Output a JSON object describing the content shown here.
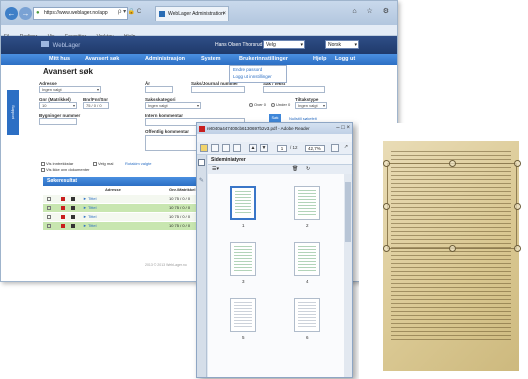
{
  "browser": {
    "url": "https://www.weblager.no/app",
    "tab_title": "WebLager Administration",
    "tab_close": "×",
    "back": "←",
    "forward": "→",
    "addr_tools": "ρ ▾ 🔒 C",
    "win_controls": "⌂ ☆ ⚙",
    "menu": [
      "Fil",
      "Rediger",
      "Vis",
      "Favoritter",
      "Verktøy",
      "Hjelp"
    ]
  },
  "site": {
    "logo": "WebLager",
    "welcome": "Hans Olsen Thorsrud",
    "user_select": "Velg",
    "lang_select": "Norsk",
    "nav": [
      "Mitt hus",
      "Avansert søk",
      "Administrasjon",
      "System",
      "Brukerinnstillinger",
      "Hjelp",
      "Logg ut"
    ],
    "dropdown": [
      "Endre passord",
      "Logg ut innstillinger"
    ]
  },
  "search": {
    "title": "Avansert søk",
    "side_tab": "Support",
    "labels": {
      "adresse": "Adresse",
      "ar": "År",
      "saksjournal": "Saks/Journal nummer",
      "sak_tekst": "Sak / tekst",
      "gnr": "Gnr (Matrikkel)",
      "bnr": "Bnr/Fnr/Snr",
      "saksskategori": "Saksskategori",
      "tiltakstype": "Tiltakstype",
      "bygninger": "Bygninger nummer",
      "intern": "Intern kommentar",
      "offentlig": "Offentlig kommentar"
    },
    "values": {
      "adresse": "Ingen valgt",
      "gnr": "10",
      "bnr": "75 / 0 / 0",
      "saksskategori": "Ingen valgt",
      "tiltakstype": "Ingen valgt"
    },
    "radio_1": "Over 0",
    "radio_2": "Under 0",
    "search_button": "Søk",
    "reset_link": "Nullstill søkefelt",
    "checks": [
      "Vis inntrekkstar",
      "Vis ikke ovn dokumenter",
      "Velg mal",
      "Rotakim valgte"
    ],
    "results_title": "Søkeresultat",
    "results_cols": [
      "Adresse",
      "Gnr./Matrikkel"
    ],
    "rows": [
      {
        "adresse": "► Tittel",
        "gnr": "10 75 / 0 / 0",
        "style": "white"
      },
      {
        "adresse": "► Tittel",
        "gnr": "10 75 / 0 / 0",
        "style": "green"
      },
      {
        "adresse": "► Tittel",
        "gnr": "10 75 / 0 / 0",
        "style": "white"
      },
      {
        "adresse": "► Tittel",
        "gnr": "10 75 / 0 / 0",
        "style": "green"
      }
    ],
    "footer": "2013 © 2013 WebLager.no"
  },
  "pdf": {
    "title": "ret040a447400cb6130697b2v3.pdf - Adobe Reader",
    "win_controls": "– □ ×",
    "menu": [
      "Fil",
      "Rediger",
      "Vis",
      "Vindu",
      "Hjelp"
    ],
    "page_current": "1",
    "page_count": "/ 12",
    "zoom": "42,7%",
    "panel_title": "Sideminiatyrer",
    "thumbs": [
      "1",
      "2",
      "3",
      "4",
      "5",
      "6"
    ],
    "selected_page": "1"
  },
  "colors": {
    "site_header": "#1f3a6b",
    "nav_blue": "#2c6fc4",
    "row_green": "#c8e6b0",
    "pdf_red": "#c81e1e",
    "scan_paper": "#d9c791"
  }
}
